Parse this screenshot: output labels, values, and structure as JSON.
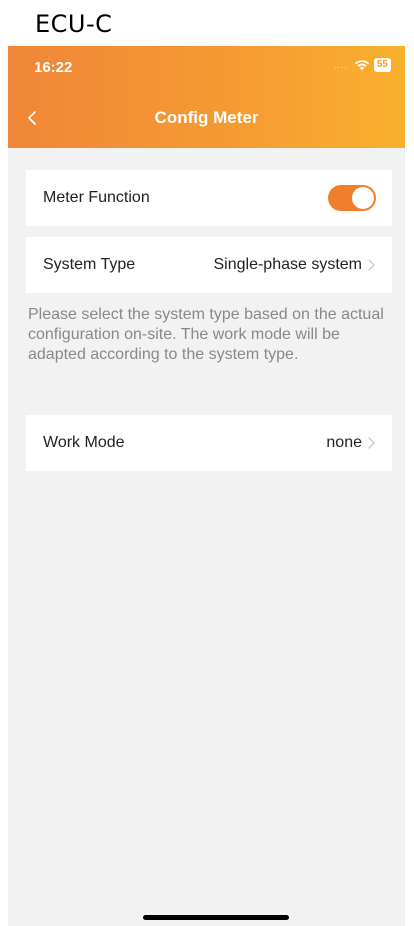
{
  "caption": "ECU-C",
  "status_bar": {
    "time": "16:22",
    "signal_dots": "....",
    "wifi_icon": "wifi-icon",
    "battery": "55"
  },
  "nav": {
    "back_icon": "chevron-left-icon",
    "title": "Config Meter"
  },
  "meter_function": {
    "label": "Meter Function",
    "enabled": true,
    "toggle_color": "#f07f2d"
  },
  "system_type": {
    "label": "System Type",
    "value": "Single-phase system"
  },
  "hint": "Please select the system type based on the actual configuration on-site. The work mode will be adapted according to the system type.",
  "work_mode": {
    "label": "Work Mode",
    "value": "none"
  },
  "colors": {
    "header_start": "#f08637",
    "header_end": "#f9b02d",
    "background": "#f2f2f2"
  }
}
